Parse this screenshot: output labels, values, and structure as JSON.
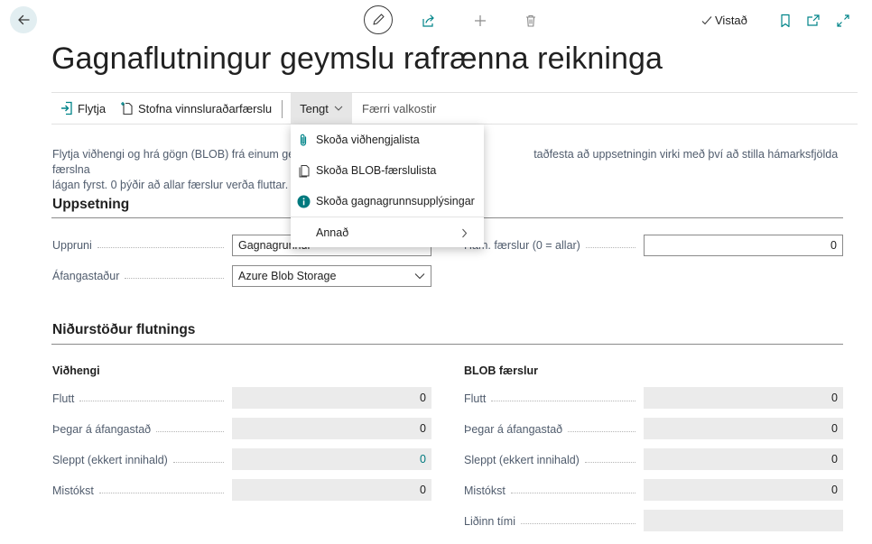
{
  "header": {
    "title": "Gagnaflutningur geymslu rafrænna reikninga",
    "saved_label": "Vistað"
  },
  "actions": {
    "move": "Flytja",
    "create_job": "Stofna vinnsluraðarfærslu",
    "related": "Tengt",
    "fewer_options": "Færri valkostir"
  },
  "menu": {
    "items": [
      {
        "label": "Skoða viðhengjalista",
        "icon": "paperclip-icon"
      },
      {
        "label": "Skoða BLOB-færslulista",
        "icon": "document-icon"
      },
      {
        "label": "Skoða gagnagrunnsupplýsingar",
        "icon": "info-icon"
      },
      {
        "label": "Annað",
        "icon": "chevron-right-icon"
      }
    ]
  },
  "description": {
    "line1_left": "Flytja viðhengi og hrá gögn (BLOB) frá einum ge",
    "line1_right": "taðfesta að uppsetningin virki með því að stilla hámarksfjölda færslna",
    "line2": "lágan fyrst. 0 þýðir að allar færslur verða fluttar."
  },
  "setup": {
    "heading": "Uppsetning",
    "source_label": "Uppruni",
    "source_value": "Gagnagrunnur",
    "destination_label": "Áfangastaður",
    "destination_value": "Azure Blob Storage",
    "max_records_label": "Hám. færslur (0 = allar)",
    "max_records_value": "0"
  },
  "results": {
    "heading": "Niðurstöður flutnings",
    "attachments": {
      "heading": "Viðhengi",
      "rows": [
        {
          "label": "Flutt",
          "value": "0"
        },
        {
          "label": "Þegar á áfangastað",
          "value": "0"
        },
        {
          "label": "Sleppt (ekkert innihald)",
          "value": "0"
        },
        {
          "label": "Mistókst",
          "value": "0"
        }
      ]
    },
    "blob": {
      "heading": "BLOB færslur",
      "rows": [
        {
          "label": "Flutt",
          "value": "0"
        },
        {
          "label": "Þegar á áfangastað",
          "value": "0"
        },
        {
          "label": "Sleppt (ekkert innihald)",
          "value": "0"
        },
        {
          "label": "Mistókst",
          "value": "0"
        },
        {
          "label": "Liðinn tími",
          "value": ""
        }
      ]
    }
  },
  "colors": {
    "accent": "#008489",
    "link_zero": "#00797e"
  }
}
